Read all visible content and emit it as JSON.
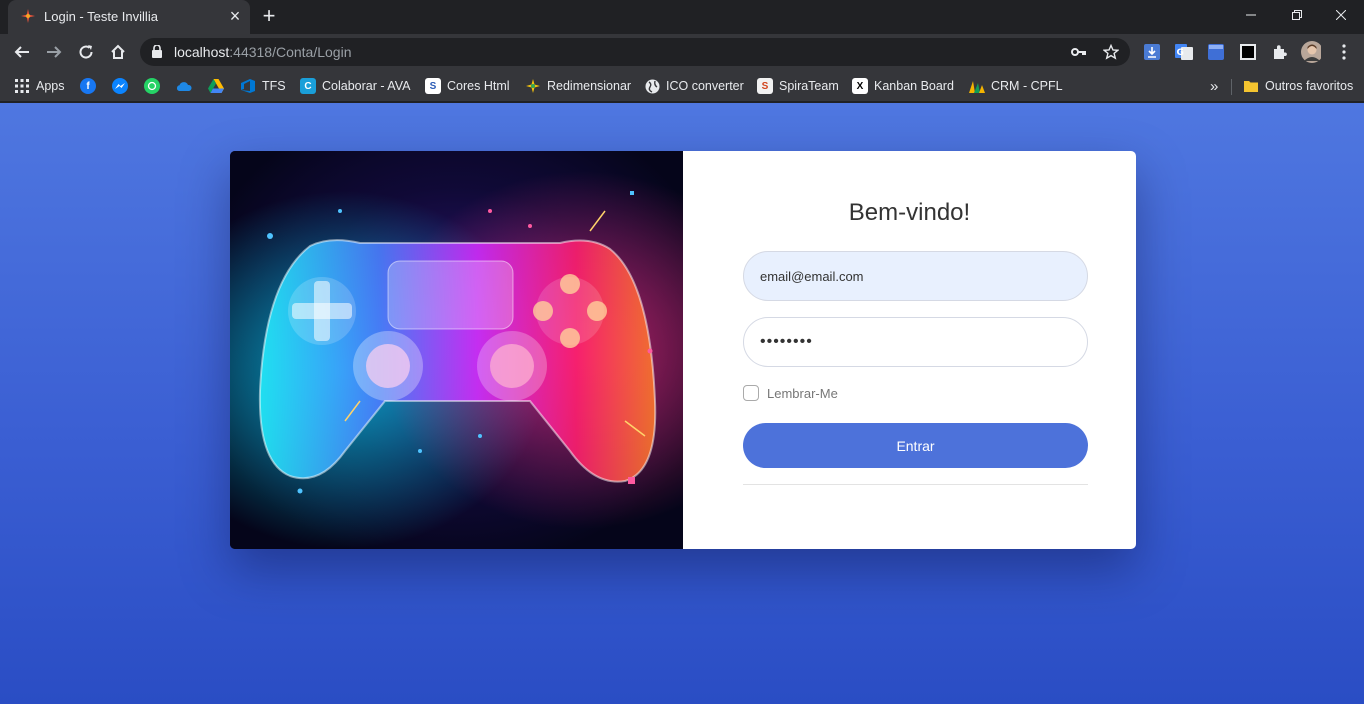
{
  "browser": {
    "tab": {
      "title": "Login - Teste Invillia"
    },
    "address_bar": {
      "host": "localhost",
      "rest": ":44318/Conta/Login"
    },
    "bookmarks": {
      "apps_label": "Apps",
      "items": [
        "TFS",
        "Colaborar - AVA",
        "Cores Html",
        "Redimensionar",
        "ICO converter",
        "SpiraTeam",
        "Kanban Board",
        "CRM - CPFL"
      ],
      "more": "»",
      "other_folder": "Outros favoritos"
    }
  },
  "login": {
    "heading": "Bem-vindo!",
    "email_value": "email@email.com",
    "password_mask": "••••••••",
    "remember_label": "Lembrar-Me",
    "submit_label": "Entrar"
  },
  "colors": {
    "page_background": "#4f77e0",
    "button": "#4d72da",
    "email_field": "#e8f0fe"
  }
}
